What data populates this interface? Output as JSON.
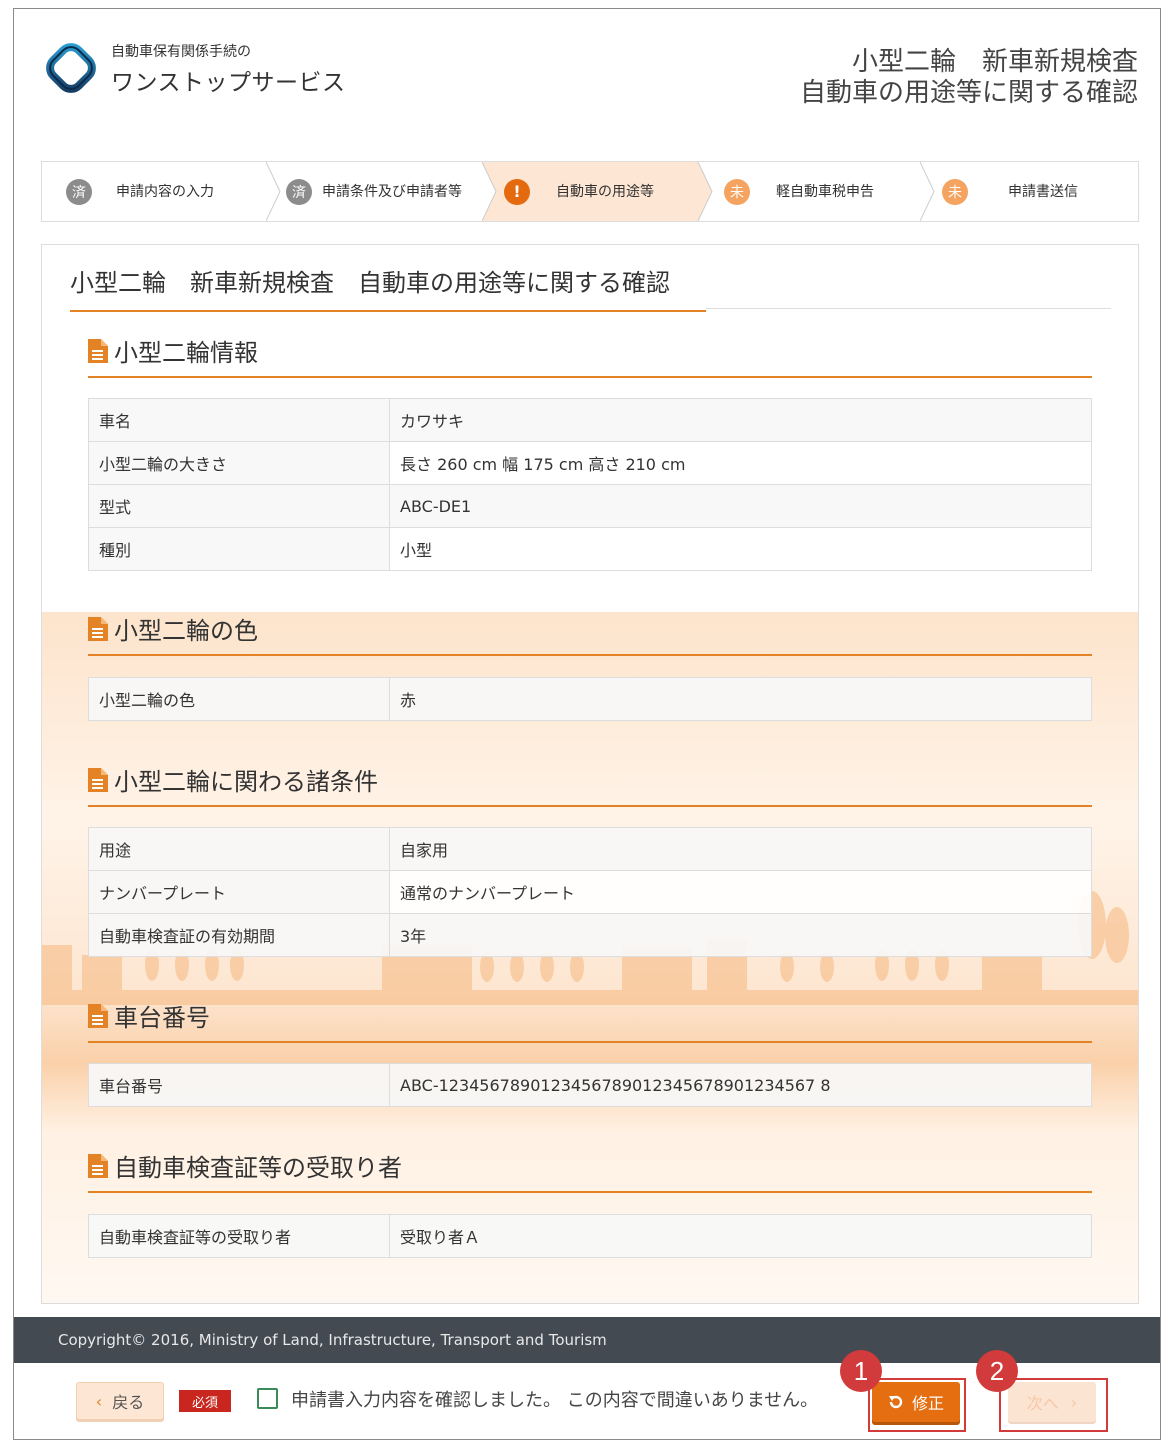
{
  "header": {
    "logo_small": "自動車保有関係手続の",
    "logo_large": "ワンストップサービス",
    "title_line1": "小型二輪　新車新規検査",
    "title_line2": "自動車の用途等に関する確認"
  },
  "steps": [
    {
      "badge": "済",
      "label": "申請内容の入力"
    },
    {
      "badge": "済",
      "label": "申請条件及び申請者等"
    },
    {
      "badge": "!",
      "label": "自動車の用途等"
    },
    {
      "badge": "未",
      "label": "軽自動車税申告"
    },
    {
      "badge": "未",
      "label": "申請書送信"
    }
  ],
  "main_title": "小型二輪　新車新規検査　自動車の用途等に関する確認",
  "sections": {
    "info": {
      "title": "小型二輪情報",
      "rows": [
        {
          "k": "車名",
          "v": "カワサキ"
        },
        {
          "k": "小型二輪の大きさ",
          "v": "長さ 260 cm  幅 175 cm  高さ 210 cm"
        },
        {
          "k": "型式",
          "v": "ABC-DE1"
        },
        {
          "k": "種別",
          "v": "小型"
        }
      ]
    },
    "color": {
      "title": "小型二輪の色",
      "rows": [
        {
          "k": "小型二輪の色",
          "v": "赤"
        }
      ]
    },
    "conditions": {
      "title": "小型二輪に関わる諸条件",
      "rows": [
        {
          "k": "用途",
          "v": "自家用"
        },
        {
          "k": "ナンバープレート",
          "v": "通常のナンバープレート"
        },
        {
          "k": "自動車検査証の有効期間",
          "v": "3年"
        }
      ]
    },
    "chassis": {
      "title": "車台番号",
      "rows": [
        {
          "k": "車台番号",
          "v": "ABC-1234567890123456789012345678901234567 8"
        }
      ]
    },
    "receiver": {
      "title": "自動車検査証等の受取り者",
      "rows": [
        {
          "k": "自動車検査証等の受取り者",
          "v": "受取り者Ａ"
        }
      ]
    }
  },
  "footer": {
    "copyright": "Copyright© 2016, Ministry of Land, Infrastructure, Transport and Tourism"
  },
  "actions": {
    "back_label": "戻る",
    "back_icon": "‹",
    "required_label": "必須",
    "confirm_text": "申請書入力内容を確認しました。 この内容で間違いありません。",
    "fix_label": "修正",
    "next_label": "次へ",
    "next_icon": "›",
    "marker_1": "1",
    "marker_2": "2"
  },
  "colors": {
    "accent": "#e48326",
    "button_orange": "#e46e10",
    "footer_bg": "#444a51",
    "highlight_red": "#d33a3a"
  }
}
